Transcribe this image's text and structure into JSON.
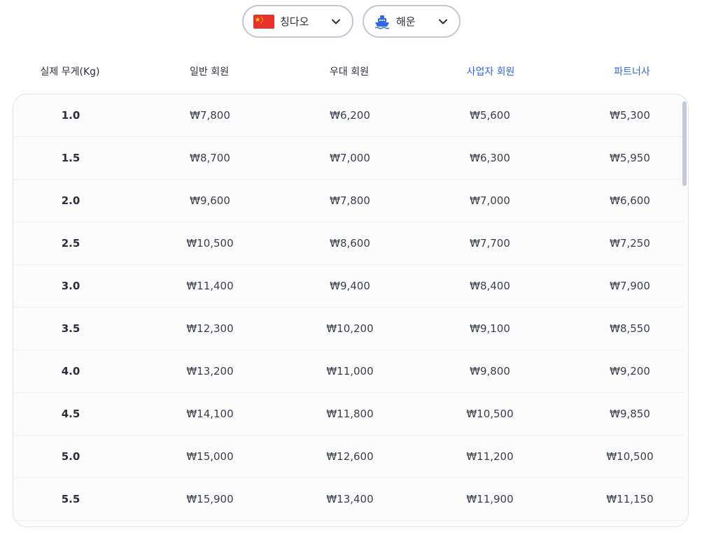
{
  "selectors": {
    "origin": {
      "label": "칭다오",
      "icon": "china-flag-icon"
    },
    "method": {
      "label": "해운",
      "icon": "ship-icon"
    }
  },
  "table": {
    "columns": [
      "실제 무게(Kg)",
      "일반 회원",
      "우대 회원",
      "사업자 회원",
      "파트너사"
    ],
    "highlight_color": "#2e66e6",
    "rows": [
      [
        "1.0",
        "₩7,800",
        "₩6,200",
        "₩5,600",
        "₩5,300"
      ],
      [
        "1.5",
        "₩8,700",
        "₩7,000",
        "₩6,300",
        "₩5,950"
      ],
      [
        "2.0",
        "₩9,600",
        "₩7,800",
        "₩7,000",
        "₩6,600"
      ],
      [
        "2.5",
        "₩10,500",
        "₩8,600",
        "₩7,700",
        "₩7,250"
      ],
      [
        "3.0",
        "₩11,400",
        "₩9,400",
        "₩8,400",
        "₩7,900"
      ],
      [
        "3.5",
        "₩12,300",
        "₩10,200",
        "₩9,100",
        "₩8,550"
      ],
      [
        "4.0",
        "₩13,200",
        "₩11,000",
        "₩9,800",
        "₩9,200"
      ],
      [
        "4.5",
        "₩14,100",
        "₩11,800",
        "₩10,500",
        "₩9,850"
      ],
      [
        "5.0",
        "₩15,000",
        "₩12,600",
        "₩11,200",
        "₩10,500"
      ],
      [
        "5.5",
        "₩15,900",
        "₩13,400",
        "₩11,900",
        "₩11,150"
      ]
    ]
  }
}
